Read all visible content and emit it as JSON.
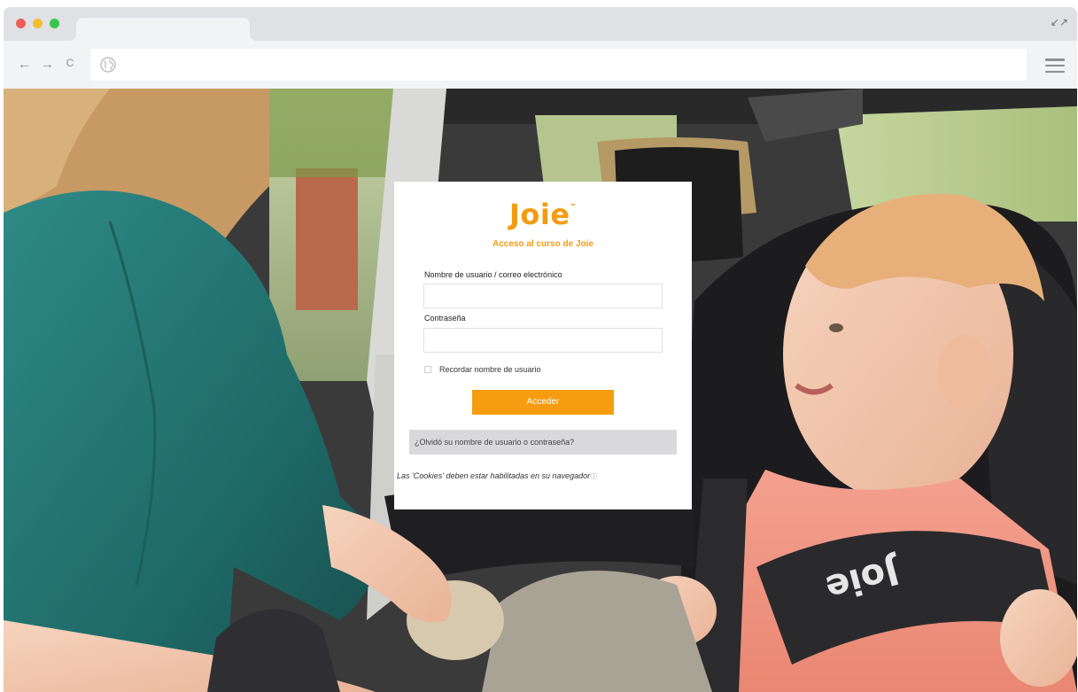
{
  "browser": {
    "dots": [
      "#ee5e57",
      "#f4bc2f",
      "#37c648"
    ],
    "icons": {
      "back": "←",
      "forward": "→",
      "reload": "C",
      "expand": "↙↗",
      "site": "globe-icon",
      "menu": "hamburger-icon"
    }
  },
  "login": {
    "brand": "Joie",
    "trademark": "™",
    "subtitle": "Acceso al curso de Joie",
    "username_label": "Nombre de usuario / correo electrónico",
    "username_value": "",
    "password_label": "Contraseña",
    "password_value": "",
    "remember_label": "Recordar nombre de usuario",
    "remember_checked": false,
    "submit_label": "Acceder",
    "forgot_label": "¿Olvidó su nombre de usuario o contraseña?",
    "cookies_note": "Las 'Cookies' deben estar habilitadas en su navegador",
    "cookies_help_icon": "ⓘ"
  },
  "colors": {
    "brand_orange": "#f39c12",
    "button_orange": "#f59c11",
    "forgot_bg": "#d9d9dc"
  },
  "background_photo": {
    "strap_text": "Joie"
  }
}
